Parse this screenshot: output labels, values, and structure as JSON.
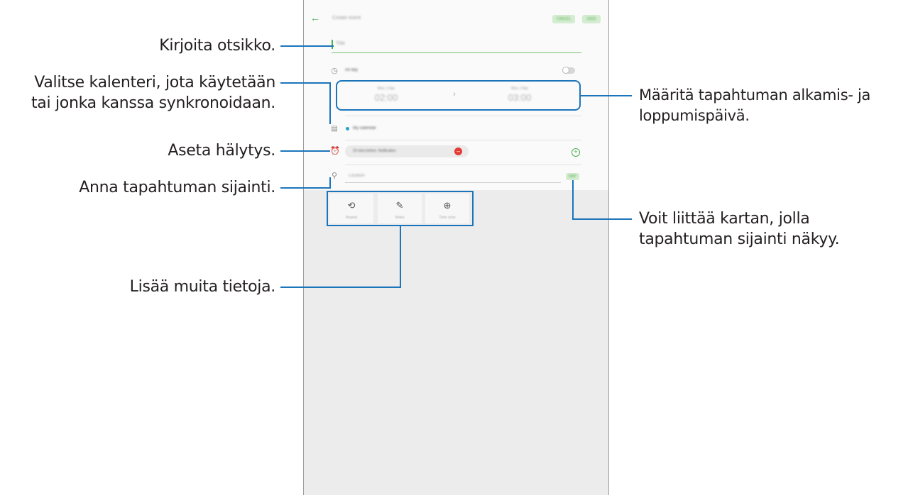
{
  "header": {
    "back_icon": "back-arrow-icon",
    "title": "Create event",
    "cancel_label": "CANCEL",
    "save_label": "SAVE"
  },
  "form": {
    "title_placeholder": "Title",
    "all_day_label": "All day",
    "start": {
      "date": "Mon, 3 Apr",
      "time": "02:00"
    },
    "end": {
      "date": "Mon, 3 Apr",
      "time": "03:00"
    },
    "calendar_label": "My calendar",
    "reminder_label": "10 mins before, Notification",
    "location_placeholder": "Location",
    "map_label": "MAP"
  },
  "options": [
    {
      "icon": "repeat-icon",
      "label": "Repeat"
    },
    {
      "icon": "notes-icon",
      "label": "Notes"
    },
    {
      "icon": "time-zone-icon",
      "label": "Time zone"
    }
  ],
  "callouts": {
    "title": "Kirjoita otsikko.",
    "calendar_line1": "Valitse kalenteri, jota käytetään",
    "calendar_line2": "tai jonka kanssa synkronoidaan.",
    "alarm": "Aseta hälytys.",
    "location": "Anna tapahtuman sijainti.",
    "more_info": "Lisää muita tietoja.",
    "dates_line1": "Määritä tapahtuman alkamis- ja",
    "dates_line2": "loppumispäivä.",
    "map_line1": "Voit liittää kartan, jolla",
    "map_line2": "tapahtuman sijainti näkyy."
  },
  "colors": {
    "accent": "#1b75bb",
    "green": "#4caf50",
    "calendar_dot": "#2aa1c7",
    "remove": "#e53935"
  }
}
